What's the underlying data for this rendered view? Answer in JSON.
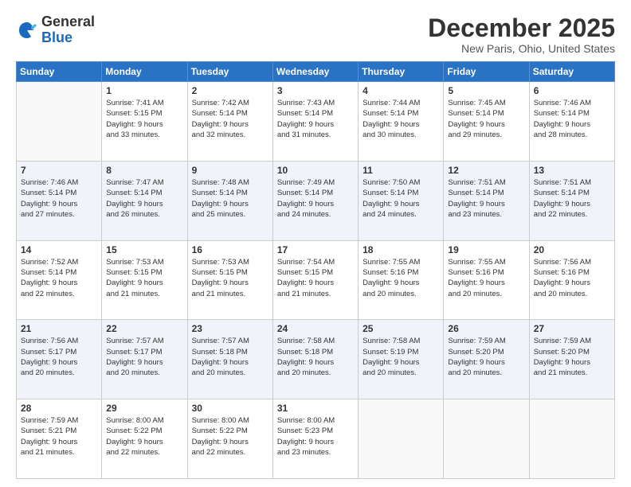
{
  "header": {
    "logo": {
      "general": "General",
      "blue": "Blue"
    },
    "title": "December 2025",
    "location": "New Paris, Ohio, United States"
  },
  "days_of_week": [
    "Sunday",
    "Monday",
    "Tuesday",
    "Wednesday",
    "Thursday",
    "Friday",
    "Saturday"
  ],
  "weeks": [
    {
      "days": [
        {
          "num": "",
          "info": ""
        },
        {
          "num": "1",
          "info": "Sunrise: 7:41 AM\nSunset: 5:15 PM\nDaylight: 9 hours\nand 33 minutes."
        },
        {
          "num": "2",
          "info": "Sunrise: 7:42 AM\nSunset: 5:14 PM\nDaylight: 9 hours\nand 32 minutes."
        },
        {
          "num": "3",
          "info": "Sunrise: 7:43 AM\nSunset: 5:14 PM\nDaylight: 9 hours\nand 31 minutes."
        },
        {
          "num": "4",
          "info": "Sunrise: 7:44 AM\nSunset: 5:14 PM\nDaylight: 9 hours\nand 30 minutes."
        },
        {
          "num": "5",
          "info": "Sunrise: 7:45 AM\nSunset: 5:14 PM\nDaylight: 9 hours\nand 29 minutes."
        },
        {
          "num": "6",
          "info": "Sunrise: 7:46 AM\nSunset: 5:14 PM\nDaylight: 9 hours\nand 28 minutes."
        }
      ]
    },
    {
      "days": [
        {
          "num": "7",
          "info": "Sunrise: 7:46 AM\nSunset: 5:14 PM\nDaylight: 9 hours\nand 27 minutes."
        },
        {
          "num": "8",
          "info": "Sunrise: 7:47 AM\nSunset: 5:14 PM\nDaylight: 9 hours\nand 26 minutes."
        },
        {
          "num": "9",
          "info": "Sunrise: 7:48 AM\nSunset: 5:14 PM\nDaylight: 9 hours\nand 25 minutes."
        },
        {
          "num": "10",
          "info": "Sunrise: 7:49 AM\nSunset: 5:14 PM\nDaylight: 9 hours\nand 24 minutes."
        },
        {
          "num": "11",
          "info": "Sunrise: 7:50 AM\nSunset: 5:14 PM\nDaylight: 9 hours\nand 24 minutes."
        },
        {
          "num": "12",
          "info": "Sunrise: 7:51 AM\nSunset: 5:14 PM\nDaylight: 9 hours\nand 23 minutes."
        },
        {
          "num": "13",
          "info": "Sunrise: 7:51 AM\nSunset: 5:14 PM\nDaylight: 9 hours\nand 22 minutes."
        }
      ]
    },
    {
      "days": [
        {
          "num": "14",
          "info": "Sunrise: 7:52 AM\nSunset: 5:14 PM\nDaylight: 9 hours\nand 22 minutes."
        },
        {
          "num": "15",
          "info": "Sunrise: 7:53 AM\nSunset: 5:15 PM\nDaylight: 9 hours\nand 21 minutes."
        },
        {
          "num": "16",
          "info": "Sunrise: 7:53 AM\nSunset: 5:15 PM\nDaylight: 9 hours\nand 21 minutes."
        },
        {
          "num": "17",
          "info": "Sunrise: 7:54 AM\nSunset: 5:15 PM\nDaylight: 9 hours\nand 21 minutes."
        },
        {
          "num": "18",
          "info": "Sunrise: 7:55 AM\nSunset: 5:16 PM\nDaylight: 9 hours\nand 20 minutes."
        },
        {
          "num": "19",
          "info": "Sunrise: 7:55 AM\nSunset: 5:16 PM\nDaylight: 9 hours\nand 20 minutes."
        },
        {
          "num": "20",
          "info": "Sunrise: 7:56 AM\nSunset: 5:16 PM\nDaylight: 9 hours\nand 20 minutes."
        }
      ]
    },
    {
      "days": [
        {
          "num": "21",
          "info": "Sunrise: 7:56 AM\nSunset: 5:17 PM\nDaylight: 9 hours\nand 20 minutes."
        },
        {
          "num": "22",
          "info": "Sunrise: 7:57 AM\nSunset: 5:17 PM\nDaylight: 9 hours\nand 20 minutes."
        },
        {
          "num": "23",
          "info": "Sunrise: 7:57 AM\nSunset: 5:18 PM\nDaylight: 9 hours\nand 20 minutes."
        },
        {
          "num": "24",
          "info": "Sunrise: 7:58 AM\nSunset: 5:18 PM\nDaylight: 9 hours\nand 20 minutes."
        },
        {
          "num": "25",
          "info": "Sunrise: 7:58 AM\nSunset: 5:19 PM\nDaylight: 9 hours\nand 20 minutes."
        },
        {
          "num": "26",
          "info": "Sunrise: 7:59 AM\nSunset: 5:20 PM\nDaylight: 9 hours\nand 20 minutes."
        },
        {
          "num": "27",
          "info": "Sunrise: 7:59 AM\nSunset: 5:20 PM\nDaylight: 9 hours\nand 21 minutes."
        }
      ]
    },
    {
      "days": [
        {
          "num": "28",
          "info": "Sunrise: 7:59 AM\nSunset: 5:21 PM\nDaylight: 9 hours\nand 21 minutes."
        },
        {
          "num": "29",
          "info": "Sunrise: 8:00 AM\nSunset: 5:22 PM\nDaylight: 9 hours\nand 22 minutes."
        },
        {
          "num": "30",
          "info": "Sunrise: 8:00 AM\nSunset: 5:22 PM\nDaylight: 9 hours\nand 22 minutes."
        },
        {
          "num": "31",
          "info": "Sunrise: 8:00 AM\nSunset: 5:23 PM\nDaylight: 9 hours\nand 23 minutes."
        },
        {
          "num": "",
          "info": ""
        },
        {
          "num": "",
          "info": ""
        },
        {
          "num": "",
          "info": ""
        }
      ]
    }
  ]
}
